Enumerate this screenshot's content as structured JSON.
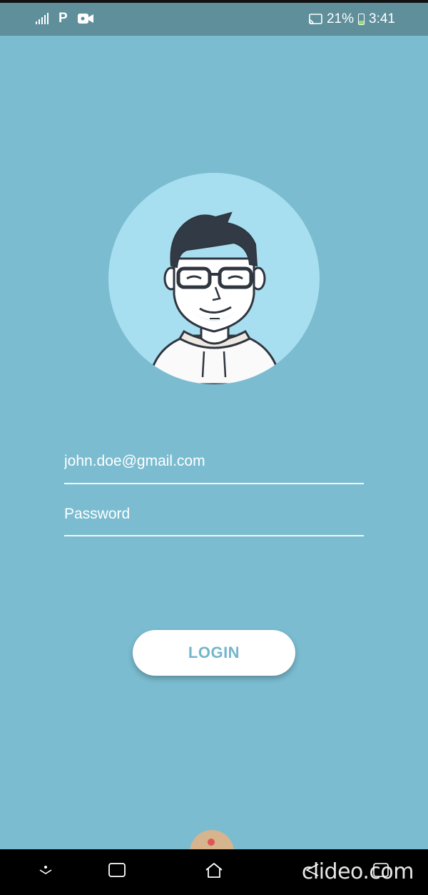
{
  "status_bar": {
    "battery_percent": "21%",
    "time": "3:41",
    "icons": [
      "signal-icon",
      "p-icon",
      "video-camera-icon",
      "cast-icon",
      "battery-charging-icon"
    ],
    "p_label": "P"
  },
  "login": {
    "email_value": "john.doe@gmail.com",
    "password_placeholder": "Password",
    "button_label": "LOGIN"
  },
  "nav_bar": {
    "icons": [
      "collapse-icon",
      "recents-icon",
      "home-icon",
      "back-icon",
      "expand-icon"
    ],
    "watermark": "clideo.com"
  },
  "colors": {
    "background": "#7bbcd0",
    "status_bar": "#5f8f9b",
    "avatar_circle": "#a8dff0",
    "button_text": "#74b6cc",
    "button_bg": "#ffffff"
  }
}
